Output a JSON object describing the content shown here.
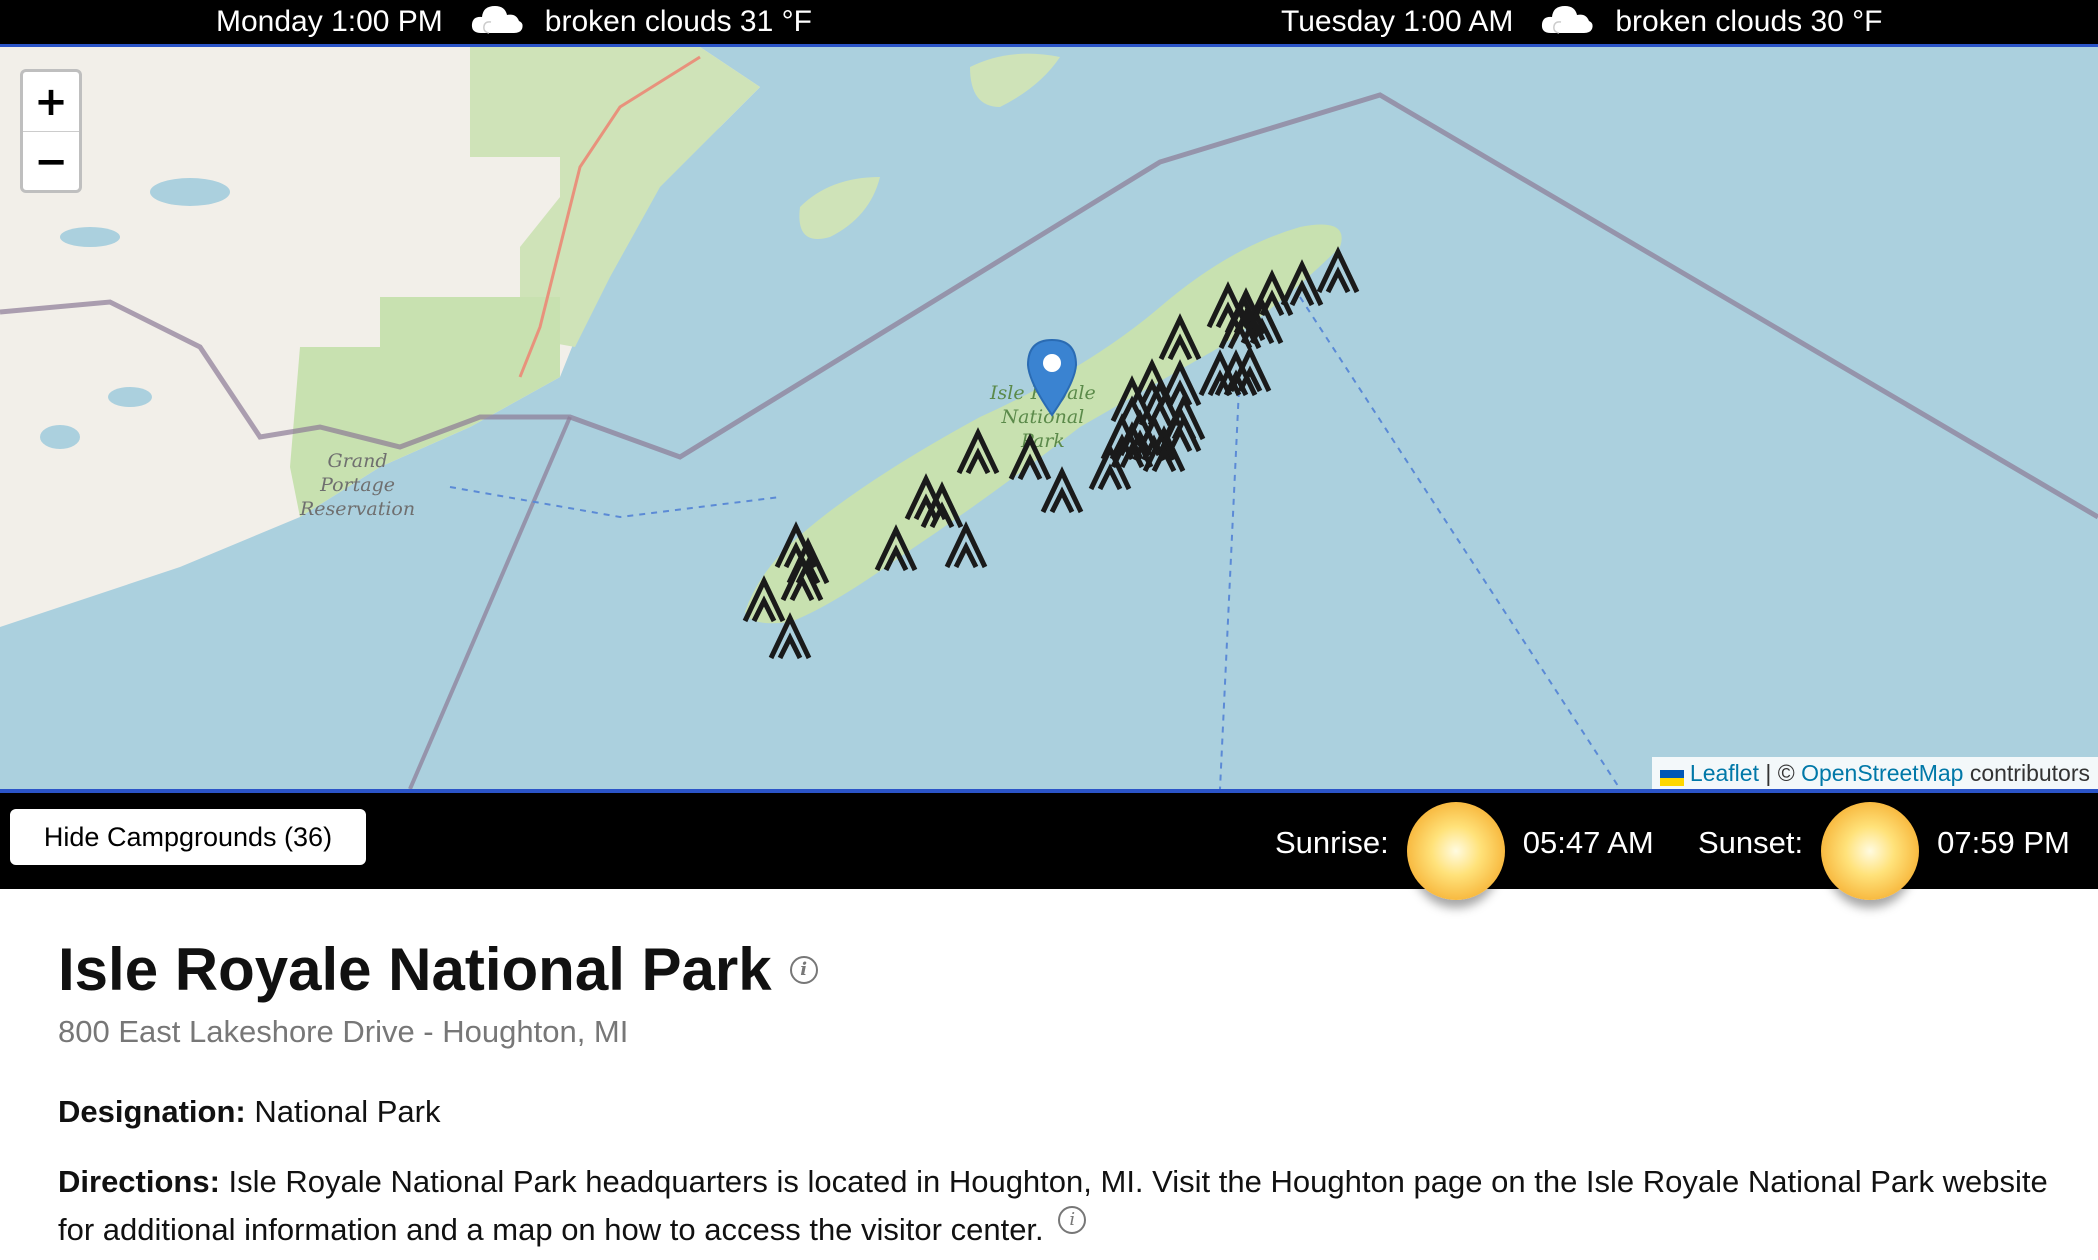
{
  "weather": [
    {
      "time": "Monday 1:00 PM",
      "icon": "cloud-icon",
      "desc": "broken clouds 31 °F"
    },
    {
      "time": "Tuesday 1:00 AM",
      "icon": "cloud-icon",
      "desc": "broken clouds 30 °F"
    }
  ],
  "map": {
    "zoom_in": "+",
    "zoom_out": "−",
    "labels": {
      "grand_portage": "Grand\nPortage\nReservation",
      "isle_label": "Isle Royale\nNational\nPark",
      "edge_label": "is"
    },
    "attribution": {
      "leaflet": "Leaflet",
      "sep": " | © ",
      "osm": "OpenStreetMap",
      "suffix": " contributors"
    },
    "colors": {
      "water": "#abd0de",
      "land": "#f2efe9",
      "park": "#c8e1b0",
      "boundary": "#8c7a96"
    }
  },
  "controls": {
    "hide_button": "Hide Campgrounds (36)",
    "sunrise_label": "Sunrise:",
    "sunrise_time": "05:47 AM",
    "sunset_label": "Sunset:",
    "sunset_time": "07:59 PM"
  },
  "park": {
    "name": "Isle Royale National Park",
    "address": "800 East Lakeshore Drive - Houghton, MI",
    "designation_label": "Designation:",
    "designation": "National Park",
    "directions_label": "Directions:",
    "directions": "Isle Royale National Park headquarters is located in Houghton, MI. Visit the Houghton page on the Isle Royale National Park website for additional information and a map on how to access the visitor center."
  }
}
